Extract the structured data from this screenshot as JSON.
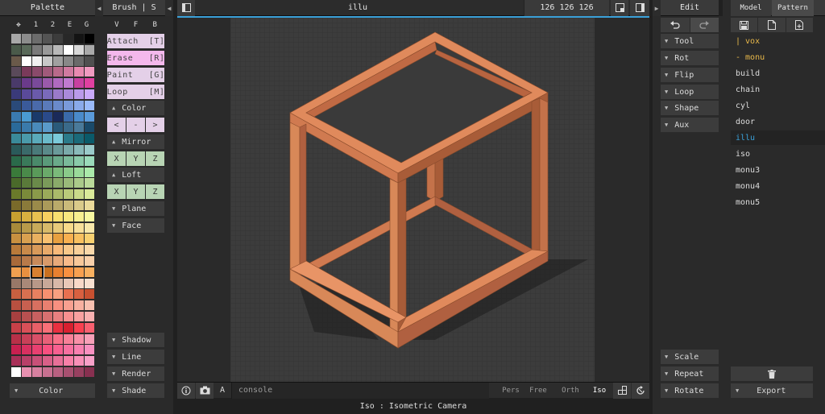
{
  "palette": {
    "title": "Palette",
    "tabs": [
      "1",
      "2",
      "E",
      "G"
    ],
    "footer": "Color"
  },
  "brush": {
    "title": "Brush | S",
    "tabs": [
      "V",
      "F",
      "B"
    ],
    "modes": [
      {
        "label": "Attach  [T]"
      },
      {
        "label": "Erase   [R]"
      },
      {
        "label": "Paint   [G]"
      },
      {
        "label": "Loop    [M]"
      }
    ],
    "color_section": "Color",
    "color_btns": [
      "<",
      "-",
      ">"
    ],
    "mirror_section": "Mirror",
    "mirror_btns": [
      "X",
      "Y",
      "Z"
    ],
    "loft_section": "Loft",
    "loft_btns": [
      "X",
      "Y",
      "Z"
    ],
    "plane": "Plane",
    "face": "Face",
    "shadow": "Shadow",
    "line": "Line",
    "render": "Render",
    "shade": "Shade"
  },
  "viewport": {
    "title": "illu",
    "dims": "126 126 126",
    "console": "console",
    "cam_btns": [
      "Pers",
      "Free",
      "Orth",
      "Iso"
    ],
    "status": "Iso : Isometric Camera",
    "a_label": "A"
  },
  "edit": {
    "title": "Edit",
    "sections": [
      "Tool",
      "Rot",
      "Flip",
      "Loop",
      "Shape",
      "Aux"
    ],
    "bottom": [
      "Scale",
      "Repeat",
      "Rotate"
    ]
  },
  "model": {
    "tab_model": "Model",
    "tab_pattern": "Pattern",
    "items": [
      "| vox",
      "- monu",
      "build",
      "chain",
      "cyl",
      "door",
      "illu",
      "iso",
      "monu3",
      "monu4",
      "monu5"
    ],
    "export": "Export"
  },
  "colors": {
    "accent": "#3aa0d8",
    "erase": "#f4b8ec",
    "mode": "#e4d0e8",
    "axis": "#b8d4b4",
    "color_btn": "#e4d0e8",
    "model_yellow": "#e8b84a",
    "model_selected": "#3aa0d8"
  }
}
